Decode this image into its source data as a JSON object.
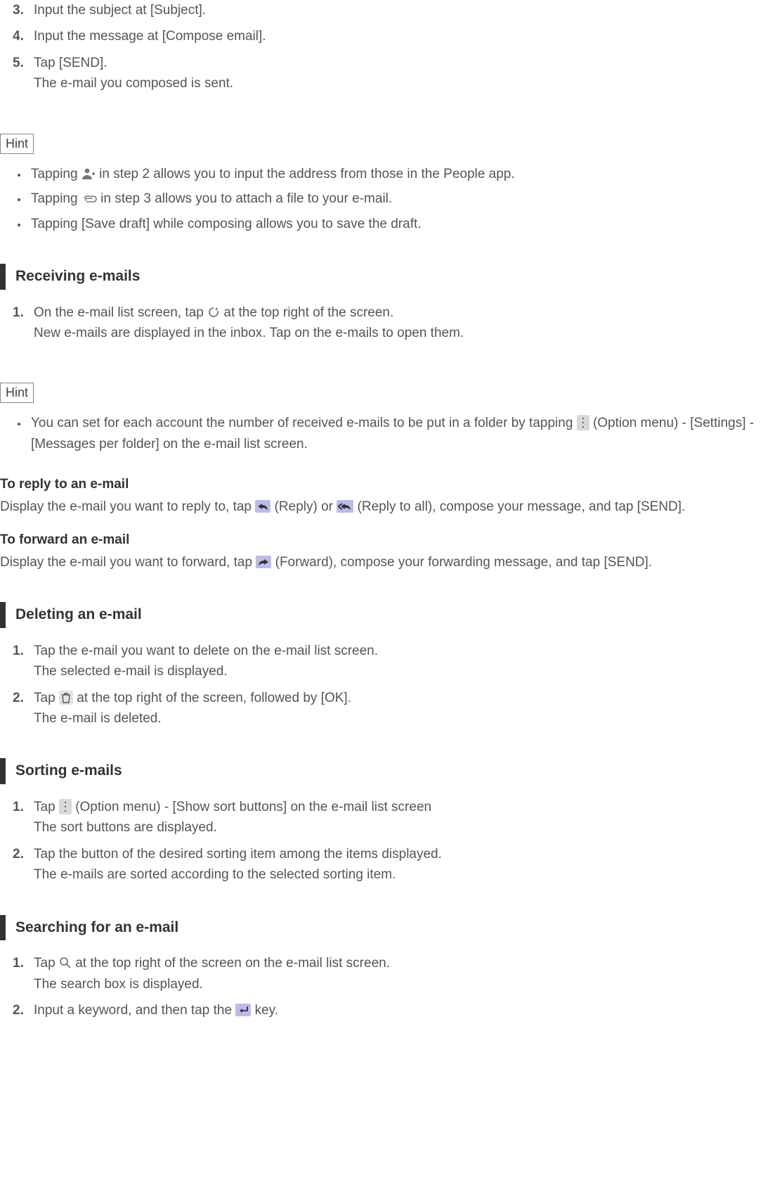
{
  "intro_steps": [
    {
      "n": "3.",
      "main": "Input the subject at [Subject]."
    },
    {
      "n": "4.",
      "main": "Input the message at [Compose email]."
    },
    {
      "n": "5.",
      "main": "Tap [SEND].",
      "sub": "The e-mail you composed is sent."
    }
  ],
  "hint1_label": "Hint",
  "hint1": {
    "a1": "Tapping ",
    "a2": " in step 2 allows you to input the address from those in the People app.",
    "b1": "Tapping ",
    "b2": " in step 3 allows you to attach a file to your e-mail.",
    "c": "Tapping [Save draft] while composing allows you to save the draft."
  },
  "recv_title": "Receiving e-mails",
  "recv_step": {
    "n": "1.",
    "a1": "On the e-mail list screen, tap ",
    "a2": " at the top right of the screen.",
    "sub": "New e-mails are displayed in the inbox. Tap on the e-mails to open them."
  },
  "hint2_label": "Hint",
  "hint2": {
    "a1": "You can set for each account the number of received e-mails to be put in a folder by tapping ",
    "a2": " (Option menu) - [Settings] - [Messages per folder] on the e-mail list screen."
  },
  "reply_h": "To reply to an e-mail",
  "reply": {
    "a1": "Display the e-mail you want to reply to, tap ",
    "a2": " (Reply) or ",
    "a3": " (Reply to all), compose your message, and tap [SEND]."
  },
  "fwd_h": "To forward an e-mail",
  "fwd": {
    "a1": "Display the e-mail you want to forward, tap ",
    "a2": " (Forward), compose your forwarding message, and tap [SEND]."
  },
  "del_title": "Deleting an e-mail",
  "del_steps": [
    {
      "n": "1.",
      "main": "Tap the e-mail you want to delete on the e-mail list screen.",
      "sub": "The selected e-mail is displayed."
    },
    {
      "n": "2.",
      "a1": "Tap ",
      "a2": " at the top right of the screen, followed by [OK].",
      "sub": "The e-mail is deleted."
    }
  ],
  "sort_title": "Sorting e-mails",
  "sort_steps": [
    {
      "n": "1.",
      "a1": "Tap ",
      "a2": " (Option menu) - [Show sort buttons] on the e-mail list screen",
      "sub": "The sort buttons are displayed."
    },
    {
      "n": "2.",
      "main": "Tap the button of the desired sorting item among the items displayed.",
      "sub": "The e-mails are sorted according to the selected sorting item."
    }
  ],
  "search_title": "Searching for an e-mail",
  "search_steps": [
    {
      "n": "1.",
      "a1": "Tap ",
      "a2": " at the top right of the screen on the e-mail list screen.",
      "sub": "The search box is displayed."
    },
    {
      "n": "2.",
      "a1": "Input a keyword, and then tap the ",
      "a2": " key."
    }
  ]
}
